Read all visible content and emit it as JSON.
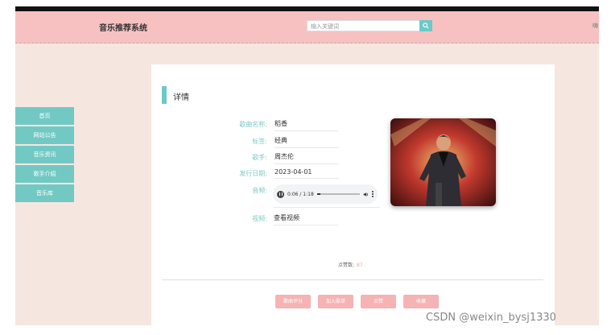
{
  "header": {
    "site_title": "音乐推荐系统",
    "search_placeholder": "输入关键词",
    "edge_text": "嗨"
  },
  "sidebar": {
    "items": [
      "首页",
      "网站公告",
      "音乐资讯",
      "歌手介绍",
      "音乐库"
    ]
  },
  "detail": {
    "heading": "详情",
    "fields": {
      "song_name_label": "歌曲名称:",
      "song_name": "稻香",
      "tag_label": "标签:",
      "tag": "经典",
      "singer_label": "歌手:",
      "singer": "周杰伦",
      "release_label": "发行日期:",
      "release": "2023-04-01",
      "audio_label": "音频:",
      "audio_time": "0:06 / 1:18",
      "audio_progress": 0.08,
      "video_label": "视频:",
      "video": "查看视频"
    },
    "likes_label": "点赞数:",
    "likes_count": "87"
  },
  "actions": {
    "rate": "歌曲评分",
    "playlist": "加入歌单",
    "like": "点赞",
    "favorite": "收藏"
  },
  "watermark": "CSDN @weixin_bysj1330",
  "colors": {
    "header_pink": "#f7c1c1",
    "teal": "#72c9c4",
    "button_pink": "#f5b3b3",
    "page_bg": "#f6e6e0"
  },
  "icons": [
    "search-icon",
    "play-icon",
    "volume-icon",
    "more-icon"
  ]
}
